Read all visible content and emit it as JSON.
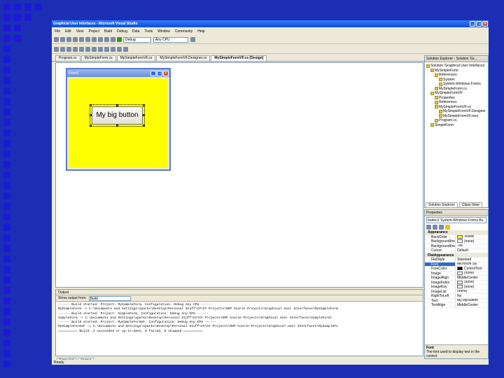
{
  "window": {
    "title": "Graphical User Interfaces - Microsoft Visual Studio"
  },
  "menu": [
    "File",
    "Edit",
    "View",
    "Project",
    "Build",
    "Debug",
    "Data",
    "Tools",
    "Window",
    "Community",
    "Help"
  ],
  "toolbar": {
    "config": "Debug",
    "platform": "Any CPU"
  },
  "tabs": [
    {
      "label": "Program.cs",
      "active": false
    },
    {
      "label": "MySimpleForm.cs",
      "active": false
    },
    {
      "label": "MySimpleFormVF.cs",
      "active": false
    },
    {
      "label": "MySimpleFormVF.Designer.cs",
      "active": false
    },
    {
      "label": "MySimpleFormVF.cs [Design]",
      "active": true
    }
  ],
  "designer": {
    "form_title": "Form1",
    "button_text": "My big button",
    "form_color": "#ffff00"
  },
  "output": {
    "title": "Output",
    "show_from_label": "Show output from:",
    "show_from_value": "Build",
    "lines": [
      "------ Build started: Project: MySimpleForm, Configuration: Debug Any CPU ------",
      "MySimpleForm -> C:\\Documents and Settings\\sparks\\Desktop\\Personal Stuff\\C#\\C# Projects\\OOP Course Projects\\Graphical User Interfaces\\MySimpleForm",
      "------ Build started: Project: SimpleForm, Configuration: Debug Any CPU ------",
      "SimpleForm -> C:\\Documents and Settings\\sparks\\Desktop\\Personal Stuff\\C#\\C# Projects\\OOP Course Projects\\Graphical User Interfaces\\SimpleForm\\",
      "------ Build started: Project: MySimpleFormVF, Configuration: Debug Any CPU ------",
      "MySimpleFormVF -> C:\\Documents and Settings\\sparks\\Desktop\\Personal Stuff\\C#\\C# Projects\\OOP Course Projects\\Graphical User Interfaces\\MySimpleFo",
      "========== Build: 3 succeeded or up-to-date, 0 failed, 0 skipped =========="
    ]
  },
  "bottom_tabs": [
    {
      "label": "Error List",
      "active": false
    },
    {
      "label": "Output",
      "active": true
    }
  ],
  "status": "Ready",
  "solution_explorer": {
    "title": "Solution Explorer - Solution 'Gr...",
    "items": [
      {
        "label": "Solution 'Graphical User Interfaces'",
        "indent": 0
      },
      {
        "label": "MySimpleForm",
        "indent": 1
      },
      {
        "label": "References",
        "indent": 2
      },
      {
        "label": "System",
        "indent": 3
      },
      {
        "label": "System.Windows.Forms",
        "indent": 3
      },
      {
        "label": "MySimpleForm.cs",
        "indent": 2
      },
      {
        "label": "MySimpleFormVF",
        "indent": 1
      },
      {
        "label": "Properties",
        "indent": 2
      },
      {
        "label": "References",
        "indent": 2
      },
      {
        "label": "MySimpleFormVF.cs",
        "indent": 2
      },
      {
        "label": "MySimpleFormVF.Designer",
        "indent": 3
      },
      {
        "label": "MySimpleFormVF.resx",
        "indent": 3
      },
      {
        "label": "Program.cs",
        "indent": 2
      },
      {
        "label": "SimpleForm",
        "indent": 1
      }
    ],
    "tabs": [
      "Solution Explorer",
      "Class View"
    ]
  },
  "properties": {
    "title": "Properties",
    "object": "button1 System.Windows.Forms.Bu",
    "rows": [
      {
        "type": "cat",
        "name": "Appearance"
      },
      {
        "type": "prop",
        "name": "BackColor",
        "value": "Yellow",
        "swatch": "#ffff00"
      },
      {
        "type": "prop",
        "name": "BackgroundImage",
        "value": "(none)",
        "swatch": "#ffffff"
      },
      {
        "type": "prop",
        "name": "BackgroundImageLa",
        "value": "Tile"
      },
      {
        "type": "prop",
        "name": "Cursor",
        "value": "Default"
      },
      {
        "type": "cat",
        "name": "FlatAppearance"
      },
      {
        "type": "prop",
        "name": "FlatStyle",
        "value": "Standard"
      },
      {
        "type": "prop",
        "name": "Font",
        "value": "Microsoft Sa",
        "selected": true
      },
      {
        "type": "prop",
        "name": "ForeColor",
        "value": "ControlText",
        "swatch": "#000000"
      },
      {
        "type": "prop",
        "name": "Image",
        "value": "(none)",
        "swatch": "#ffffff"
      },
      {
        "type": "prop",
        "name": "ImageAlign",
        "value": "MiddleCenter"
      },
      {
        "type": "prop",
        "name": "ImageIndex",
        "value": "(none)",
        "swatch": "#ffffff"
      },
      {
        "type": "prop",
        "name": "ImageKey",
        "value": "(none)",
        "swatch": "#ffffff"
      },
      {
        "type": "prop",
        "name": "ImageList",
        "value": "(none)"
      },
      {
        "type": "prop",
        "name": "RightToLeft",
        "value": "No"
      },
      {
        "type": "prop",
        "name": "Text",
        "value": "My big button"
      },
      {
        "type": "prop",
        "name": "TextAlign",
        "value": "MiddleCenter"
      }
    ],
    "desc_title": "Font",
    "desc_text": "The font used to display text in the control."
  }
}
